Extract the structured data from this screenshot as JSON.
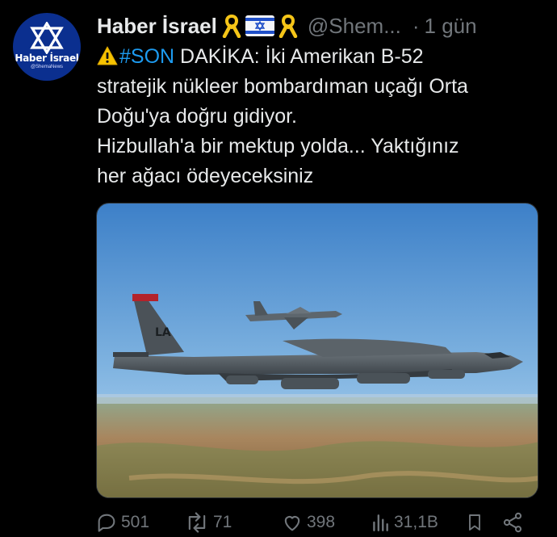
{
  "author": {
    "display_name": "Haber İsrael",
    "handle": "@Shem...",
    "avatar_brand": "Haber İsrael",
    "avatar_handle": "@ShemaNews"
  },
  "meta": {
    "separator": "·",
    "time": "1 gün"
  },
  "tweet": {
    "hashtag": "#SON",
    "line1_rest": " DAKİKA: İki Amerikan B-52",
    "line2": "stratejik nükleer bombardıman uçağı Orta",
    "line3": "Doğu'ya doğru gidiyor.",
    "line4": "Hizbullah'a bir mektup yolda... Yaktığınız",
    "line5": "her ağacı ödeyeceksiniz"
  },
  "media": {
    "tail_text": "LA"
  },
  "actions": {
    "reply_count": "501",
    "retweet_count": "71",
    "like_count": "398",
    "views_count": "31,1B"
  },
  "colors": {
    "link": "#1d9bf0",
    "muted": "#71767b",
    "text": "#e7e9ea",
    "background": "#000000"
  },
  "icons": [
    "warning-icon",
    "yellow-ribbon-icon",
    "israel-flag-icon",
    "reply-icon",
    "retweet-icon",
    "like-icon",
    "views-icon",
    "bookmark-icon",
    "share-icon"
  ]
}
